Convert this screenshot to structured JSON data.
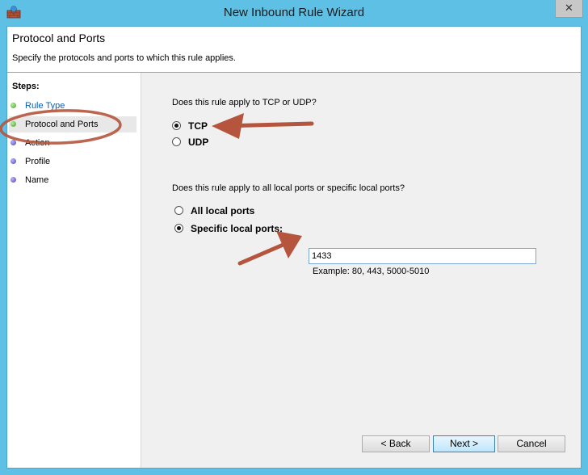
{
  "window": {
    "title": "New Inbound Rule Wizard",
    "close_glyph": "✕",
    "app_icon": "firewall-icon"
  },
  "header": {
    "title": "Protocol and Ports",
    "subtitle": "Specify the protocols and ports to which this rule applies."
  },
  "steps": {
    "label": "Steps:",
    "items": [
      {
        "label": "Rule Type",
        "status": "completed"
      },
      {
        "label": "Protocol and Ports",
        "status": "current"
      },
      {
        "label": "Action",
        "status": "pending"
      },
      {
        "label": "Profile",
        "status": "pending"
      },
      {
        "label": "Name",
        "status": "pending"
      }
    ]
  },
  "protocol": {
    "question": "Does this rule apply to TCP or UDP?",
    "options": [
      {
        "label": "TCP",
        "selected": true
      },
      {
        "label": "UDP",
        "selected": false
      }
    ]
  },
  "ports": {
    "question": "Does this rule apply to all local ports or specific local ports?",
    "options": [
      {
        "label": "All local ports",
        "selected": false
      },
      {
        "label": "Specific local ports:",
        "selected": true
      }
    ],
    "value": "1433",
    "example": "Example: 80, 443, 5000-5010"
  },
  "buttons": {
    "back": "< Back",
    "next": "Next >",
    "cancel": "Cancel"
  },
  "annotation_color": "#c0462e"
}
